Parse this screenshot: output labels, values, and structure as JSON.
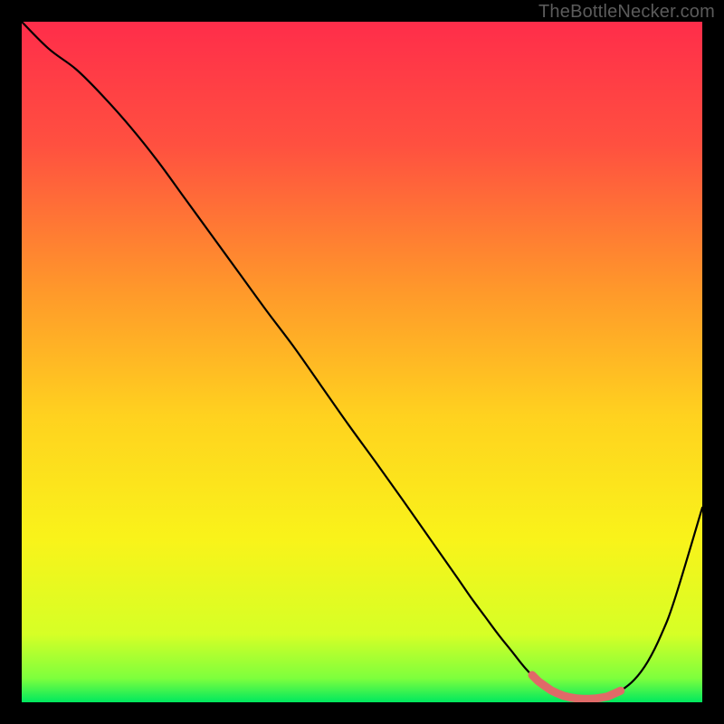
{
  "attribution": "TheBottleNecker.com",
  "chart_data": {
    "type": "line",
    "title": "",
    "xlabel": "",
    "ylabel": "",
    "xlim": [
      0,
      100
    ],
    "ylim": [
      0,
      100
    ],
    "series": [
      {
        "name": "bottleneck-curve",
        "x": [
          0,
          4,
          8,
          12,
          16,
          20,
          24,
          28,
          32,
          36,
          40,
          44,
          48,
          52,
          56,
          60,
          64,
          66,
          68,
          70,
          72,
          74,
          76,
          78,
          80,
          82,
          84,
          86,
          88,
          90,
          92,
          94,
          96,
          100
        ],
        "y": [
          100,
          96,
          93,
          89,
          84.5,
          79.5,
          74,
          68.5,
          63,
          57.5,
          52.2,
          46.5,
          40.8,
          35.3,
          29.7,
          24,
          18.3,
          15.4,
          12.7,
          10,
          7.5,
          5,
          3,
          1.6,
          0.8,
          0.5,
          0.5,
          0.8,
          1.7,
          3.3,
          6,
          10,
          15.3,
          28.6
        ]
      }
    ],
    "highlight": {
      "name": "recommended-range",
      "x_start": 75,
      "x_end": 88,
      "y": 1.2
    },
    "gradient_stops": [
      {
        "pos": 0.0,
        "color": "#ff2d4a"
      },
      {
        "pos": 0.18,
        "color": "#ff5040"
      },
      {
        "pos": 0.4,
        "color": "#ff9a2a"
      },
      {
        "pos": 0.58,
        "color": "#ffd21f"
      },
      {
        "pos": 0.76,
        "color": "#f9f31a"
      },
      {
        "pos": 0.9,
        "color": "#d6ff26"
      },
      {
        "pos": 0.965,
        "color": "#7dff3d"
      },
      {
        "pos": 1.0,
        "color": "#00e85f"
      }
    ]
  }
}
